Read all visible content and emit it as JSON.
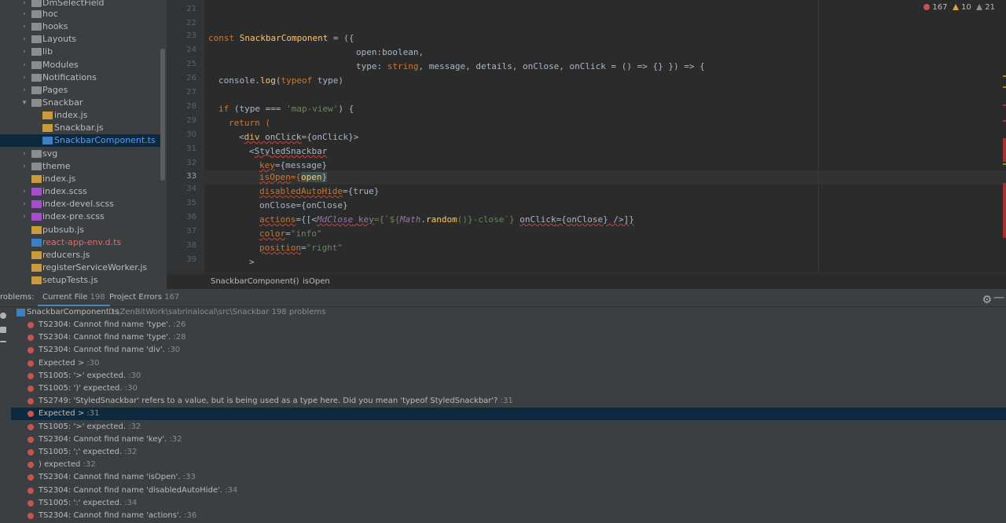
{
  "tree": {
    "items": [
      {
        "label": "DmSelectField",
        "type": "folder"
      },
      {
        "label": "hoc",
        "type": "folder"
      },
      {
        "label": "hooks",
        "type": "folder"
      },
      {
        "label": "Layouts",
        "type": "folder"
      },
      {
        "label": "lib",
        "type": "folder"
      },
      {
        "label": "Modules",
        "type": "folder"
      },
      {
        "label": "Notifications",
        "type": "folder"
      },
      {
        "label": "Pages",
        "type": "folder"
      },
      {
        "label": "Snackbar",
        "type": "folder-open"
      },
      {
        "label": "index.js",
        "type": "js"
      },
      {
        "label": "Snackbar.js",
        "type": "js"
      },
      {
        "label": "SnackbarComponent.ts",
        "type": "ts",
        "selected": true
      },
      {
        "label": "svg",
        "type": "folder"
      },
      {
        "label": "theme",
        "type": "folder"
      },
      {
        "label": "index.js",
        "type": "js"
      },
      {
        "label": "index.scss",
        "type": "scss"
      },
      {
        "label": "index-devel.scss",
        "type": "scss"
      },
      {
        "label": "index-pre.scss",
        "type": "scss"
      },
      {
        "label": "pubsub.js",
        "type": "js"
      },
      {
        "label": "react-app-env.d.ts",
        "type": "ts-red"
      },
      {
        "label": "reducers.js",
        "type": "js"
      },
      {
        "label": "registerServiceWorker.js",
        "type": "js"
      },
      {
        "label": "setupTests.js",
        "type": "js"
      }
    ]
  },
  "editor": {
    "line_numbers": [
      "21",
      "22",
      "23",
      "24",
      "25",
      "26",
      "27",
      "28",
      "29",
      "30",
      "31",
      "32",
      "33",
      "34",
      "35",
      "36",
      "37",
      "38",
      "39"
    ],
    "current_line": "33",
    "status": {
      "errors": "167",
      "warnings": "10",
      "weak_warnings": "21"
    },
    "code": {
      "l23_const": "const ",
      "l23_name": "SnackbarComponent",
      "l23_rest": " = ({",
      "l24": "open:boolean,",
      "l25_a": "type: ",
      "l25_b": "string",
      "l25_c": ", message, details, onClose, onClick = () => {} }) => {",
      "l26_a": "console",
      "l26_b": ".",
      "l26_c": "log",
      "l26_d": "(",
      "l26_e": "typeof",
      "l26_f": " type)",
      "l28_a": "if",
      "l28_b": " (type === ",
      "l28_c": "'map-view'",
      "l28_d": ") {",
      "l29": "return (",
      "l30_a": "<",
      "l30_b": "div",
      "l30_c": " onClick",
      "l30_d": "={onClick}>",
      "l31_a": "<",
      "l31_b": "StyledSnackbar",
      "l32_a": "key",
      "l32_b": "={message}",
      "l33_a": "isOpen",
      "l33_b": "={",
      "l33_c": "open",
      "l33_d": "}",
      "l34_a": "disabledAutoHide",
      "l34_b": "={true}",
      "l35": "onClose={onClose}",
      "l36_a": "actions",
      "l36_b": "={[<",
      "l36_c": "MdClose",
      "l36_d": " key",
      "l36_e": "={`${",
      "l36_f": "Math",
      "l36_g": ".",
      "l36_h": "random",
      "l36_i": "()}-close`} ",
      "l36_j": "onClick",
      "l36_k": "={onClose} />]}",
      "l37_a": "color",
      "l37_b": "=",
      "l37_c": "\"info\"",
      "l38_a": "position",
      "l38_b": "=",
      "l38_c": "\"right\"",
      "l39": ">"
    }
  },
  "breadcrumb": {
    "item1": "SnackbarComponent()",
    "sep": "›",
    "item2": "isOpen"
  },
  "problems": {
    "tabs": {
      "title": "roblems:",
      "current_file": "Current File",
      "current_file_count": "198",
      "project_errors": "Project Errors",
      "project_errors_count": "167"
    },
    "file": {
      "name": "SnackbarComponent.ts",
      "path": "D:\\ZenBitWork\\sabrinalocal\\src\\Snackbar  198 problems"
    },
    "rows": [
      {
        "text": "TS2304: Cannot find name 'type'.",
        "loc": ":26"
      },
      {
        "text": "TS2304: Cannot find name 'type'.",
        "loc": ":28"
      },
      {
        "text": "TS2304: Cannot find name 'div'.",
        "loc": ":30"
      },
      {
        "text": "Expected >",
        "loc": ":30"
      },
      {
        "text": "TS1005: '>' expected.",
        "loc": ":30"
      },
      {
        "text": "TS1005: ')' expected.",
        "loc": ":30"
      },
      {
        "text": "TS2749: 'StyledSnackbar' refers to a value, but is being used as a type here. Did you mean 'typeof StyledSnackbar'?",
        "loc": ":31"
      },
      {
        "text": "Expected >",
        "loc": ":31",
        "selected": true
      },
      {
        "text": "TS1005: '>' expected.",
        "loc": ":32"
      },
      {
        "text": "TS2304: Cannot find name 'key'.",
        "loc": ":32"
      },
      {
        "text": "TS1005: ';' expected.",
        "loc": ":32"
      },
      {
        "text": ") expected",
        "loc": ":32"
      },
      {
        "text": "TS2304: Cannot find name 'isOpen'.",
        "loc": ":33"
      },
      {
        "text": "TS2304: Cannot find name 'disabledAutoHide'.",
        "loc": ":34"
      },
      {
        "text": "TS1005: ':' expected.",
        "loc": ":34"
      },
      {
        "text": "TS2304: Cannot find name 'actions'.",
        "loc": ":36"
      }
    ]
  },
  "colors": {
    "tree_bg": "#3c3f41",
    "editor_bg": "#2b2b2b",
    "selection": "#0d293e",
    "error": "#c75450",
    "keyword": "#cc7832"
  },
  "icons": {
    "settings": "gear-icon",
    "minimize": "minimize-icon",
    "error": "error-icon",
    "warning": "warning-icon"
  }
}
